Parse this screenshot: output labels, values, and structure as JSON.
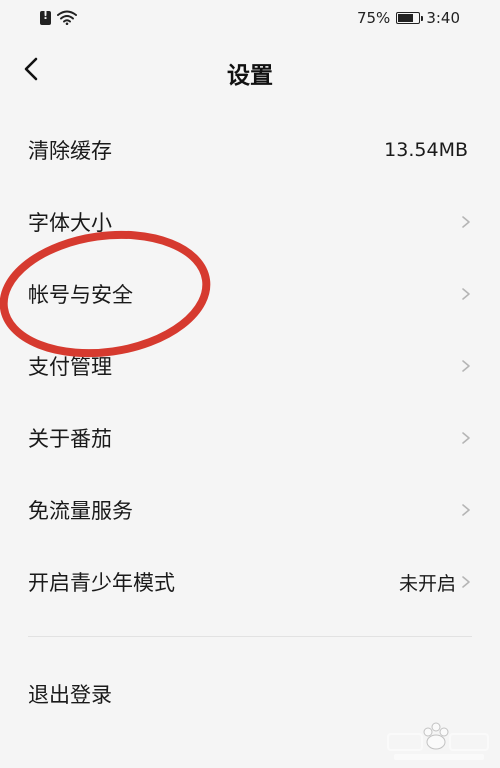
{
  "status_bar": {
    "battery_percent_text": "75%",
    "battery_level": 0.75,
    "time": "3:40"
  },
  "nav": {
    "title": "设置"
  },
  "settings": [
    {
      "label": "清除缓存",
      "value": "13.54MB",
      "chevron": false
    },
    {
      "label": "字体大小",
      "value": "",
      "chevron": true
    },
    {
      "label": "帐号与安全",
      "value": "",
      "chevron": true
    },
    {
      "label": "支付管理",
      "value": "",
      "chevron": true
    },
    {
      "label": "关于番茄",
      "value": "",
      "chevron": true
    },
    {
      "label": "免流量服务",
      "value": "",
      "chevron": true
    },
    {
      "label": "开启青少年模式",
      "value": "未开启",
      "chevron": true
    }
  ],
  "logout": {
    "label": "退出登录"
  },
  "colors": {
    "background": "#f5f5f5",
    "text": "#1a1a1a",
    "chevron": "#b5b5b5",
    "annotation": "#d63a2f"
  }
}
